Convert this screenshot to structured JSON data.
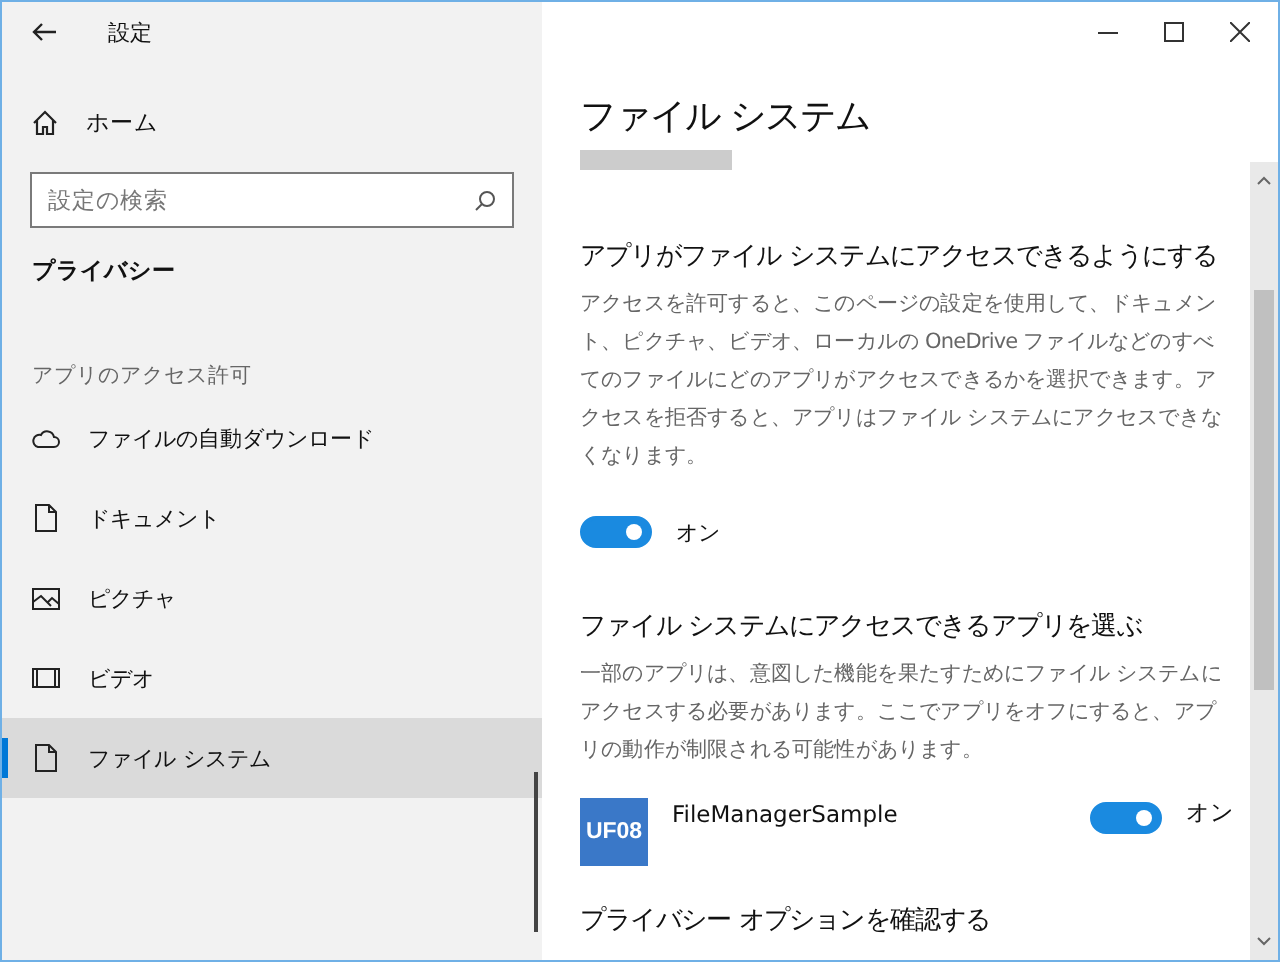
{
  "window": {
    "title": "設定"
  },
  "sidebar": {
    "home": "ホーム",
    "search": {
      "placeholder": "設定の検索"
    },
    "section": "プライバシー",
    "group_label": "アプリのアクセス許可",
    "items": [
      {
        "label": "ファイルの自動ダウンロード",
        "kind": "cloud",
        "selected": false
      },
      {
        "label": "ドキュメント",
        "kind": "document",
        "selected": false
      },
      {
        "label": "ピクチャ",
        "kind": "image",
        "selected": false
      },
      {
        "label": "ビデオ",
        "kind": "video",
        "selected": false
      },
      {
        "label": "ファイル システム",
        "kind": "document",
        "selected": true
      }
    ]
  },
  "main": {
    "title": "ファイル システム",
    "sections": [
      {
        "heading": "アプリがファイル システムにアクセスできるようにする",
        "text": "アクセスを許可すると、このページの設定を使用して、ドキュメント、ピクチャ、ビデオ、ローカルの OneDrive ファイルなどのすべてのファイルにどのアプリがアクセスできるかを選択できます。アクセスを拒否すると、アプリはファイル システムにアクセスできなくなります。",
        "toggle": {
          "on": true,
          "label": "オン"
        }
      },
      {
        "heading": "ファイル システムにアクセスできるアプリを選ぶ",
        "text": "一部のアプリは、意図した機能を果たすためにファイル システムにアクセスする必要があります。ここでアプリをオフにすると、アプリの動作が制限される可能性があります。",
        "apps": [
          {
            "icon_text": "UF08",
            "name": "FileManagerSample",
            "on": true,
            "label": "オン"
          }
        ]
      }
    ],
    "footer_heading": "プライバシー オプションを確認する"
  }
}
